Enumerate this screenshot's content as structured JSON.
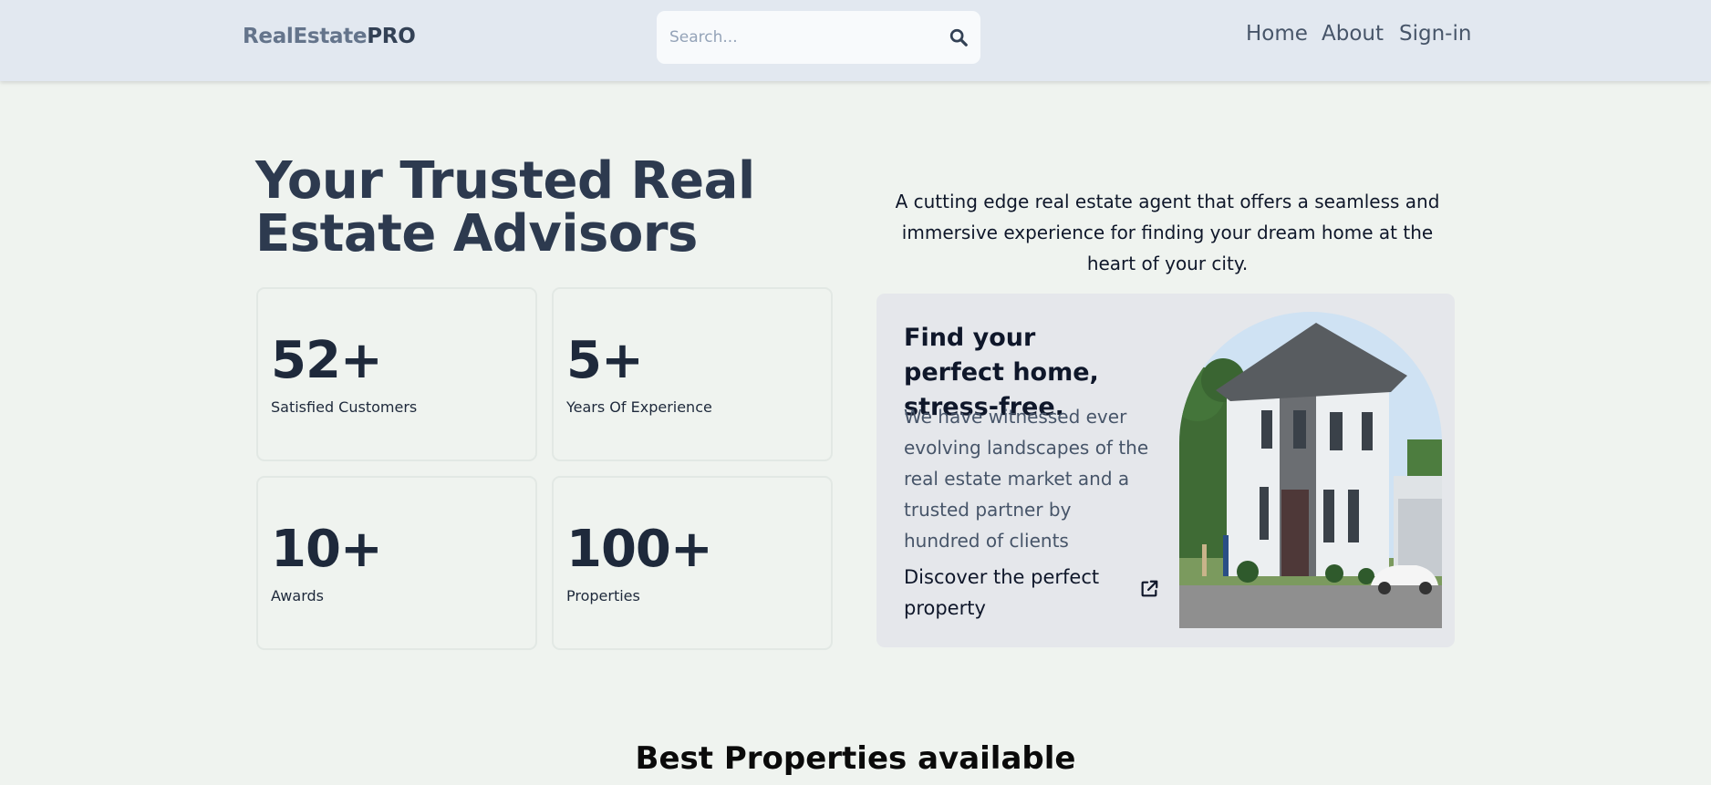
{
  "header": {
    "logo_part1": "RealEstate",
    "logo_part2": "PRO",
    "search_placeholder": "Search...",
    "search_icon": "search-icon",
    "nav": [
      "Home",
      "About",
      "Sign-in"
    ]
  },
  "hero": {
    "title": "Your Trusted Real Estate Advisors",
    "tagline": "A cutting edge real estate agent that offers a seamless and immersive experience for finding your dream home at the heart of your city.",
    "stats": [
      {
        "value": "52+",
        "label": "Satisfied Customers"
      },
      {
        "value": "5+",
        "label": "Years Of Experience"
      },
      {
        "value": "10+",
        "label": "Awards"
      },
      {
        "value": "100+",
        "label": "Properties"
      }
    ]
  },
  "feature": {
    "title": "Find your perfect home, stress-free.",
    "description": "We have witnessed ever evolving landscapes of the real estate market and a trusted partner by hundred of clients",
    "link": "Discover the perfect property",
    "link_icon": "external-link-icon",
    "image": "house-image"
  },
  "section": {
    "title": "Best Properties available"
  }
}
